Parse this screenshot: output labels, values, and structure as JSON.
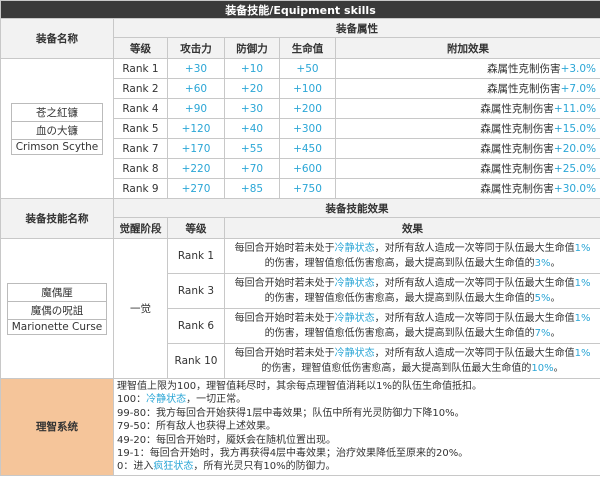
{
  "title": "装备技能/Equipment skills",
  "attr_section": {
    "name_header": "装备名称",
    "attr_header": "装备属性",
    "columns": [
      "等级",
      "攻击力",
      "防御力",
      "生命值",
      "附加效果"
    ],
    "names": [
      "苍之紅镰",
      "血の大镰",
      "Crimson Scythe"
    ],
    "effect_prefix": "森属性克制伤害",
    "rows": [
      {
        "rank": "Rank 1",
        "atk": "+30",
        "def": "+10",
        "hp": "+50",
        "bonus": "+3.0%"
      },
      {
        "rank": "Rank 2",
        "atk": "+60",
        "def": "+20",
        "hp": "+100",
        "bonus": "+7.0%"
      },
      {
        "rank": "Rank 4",
        "atk": "+90",
        "def": "+30",
        "hp": "+200",
        "bonus": "+11.0%"
      },
      {
        "rank": "Rank 5",
        "atk": "+120",
        "def": "+40",
        "hp": "+300",
        "bonus": "+15.0%"
      },
      {
        "rank": "Rank 7",
        "atk": "+170",
        "def": "+55",
        "hp": "+450",
        "bonus": "+20.0%"
      },
      {
        "rank": "Rank 8",
        "atk": "+220",
        "def": "+70",
        "hp": "+600",
        "bonus": "+25.0%"
      },
      {
        "rank": "Rank 9",
        "atk": "+270",
        "def": "+85",
        "hp": "+750",
        "bonus": "+30.0%"
      }
    ]
  },
  "skill_section": {
    "name_header": "装备技能名称",
    "effect_header": "装备技能效果",
    "columns": [
      "觉醒阶段",
      "等级",
      "效果"
    ],
    "names": [
      "魔偶厘",
      "魔偶の呪詛",
      "Marionette Curse"
    ],
    "stage": "一觉",
    "effect_parts": {
      "a": "每回合开始时若未处于",
      "b": "冷静状态",
      "c": "，对所有敌人造成一次等同于队伍最大生命值",
      "d": "的伤害，理智值愈低伤害愈高，最大提高到队伍最大生命值的",
      "e": "。"
    },
    "rows": [
      {
        "rank": "Rank 1",
        "pct": "1%",
        "max": "3%"
      },
      {
        "rank": "Rank 3",
        "pct": "1%",
        "max": "5%"
      },
      {
        "rank": "Rank 6",
        "pct": "1%",
        "max": "7%"
      },
      {
        "rank": "Rank 10",
        "pct": "1%",
        "max": "10%"
      }
    ]
  },
  "sanity": {
    "label": "理智系统",
    "line1": "理智值上限为100，理智值耗尽时，其余每点理智值消耗以1%的队伍生命值抵扣。",
    "line2_prefix": "100：",
    "line2_hl": "冷静状态",
    "line2_suffix": "，一切正常。",
    "line3": "99-80：我方每回合开始获得1层中毒效果；队伍中所有光灵防御力下降10%。",
    "line4": "79-50：所有敌人也获得上述效果。",
    "line5": "49-20：每回合开始时，魇妖会在随机位置出现。",
    "line6": "19-1：每回合开始时，我方再获得4层中毒效果；治疗效果降低至原来的20%。",
    "line7_prefix": "0：进入",
    "line7_hl": "疯狂状态",
    "line7_suffix": "，所有光灵只有10%的防御力。"
  }
}
